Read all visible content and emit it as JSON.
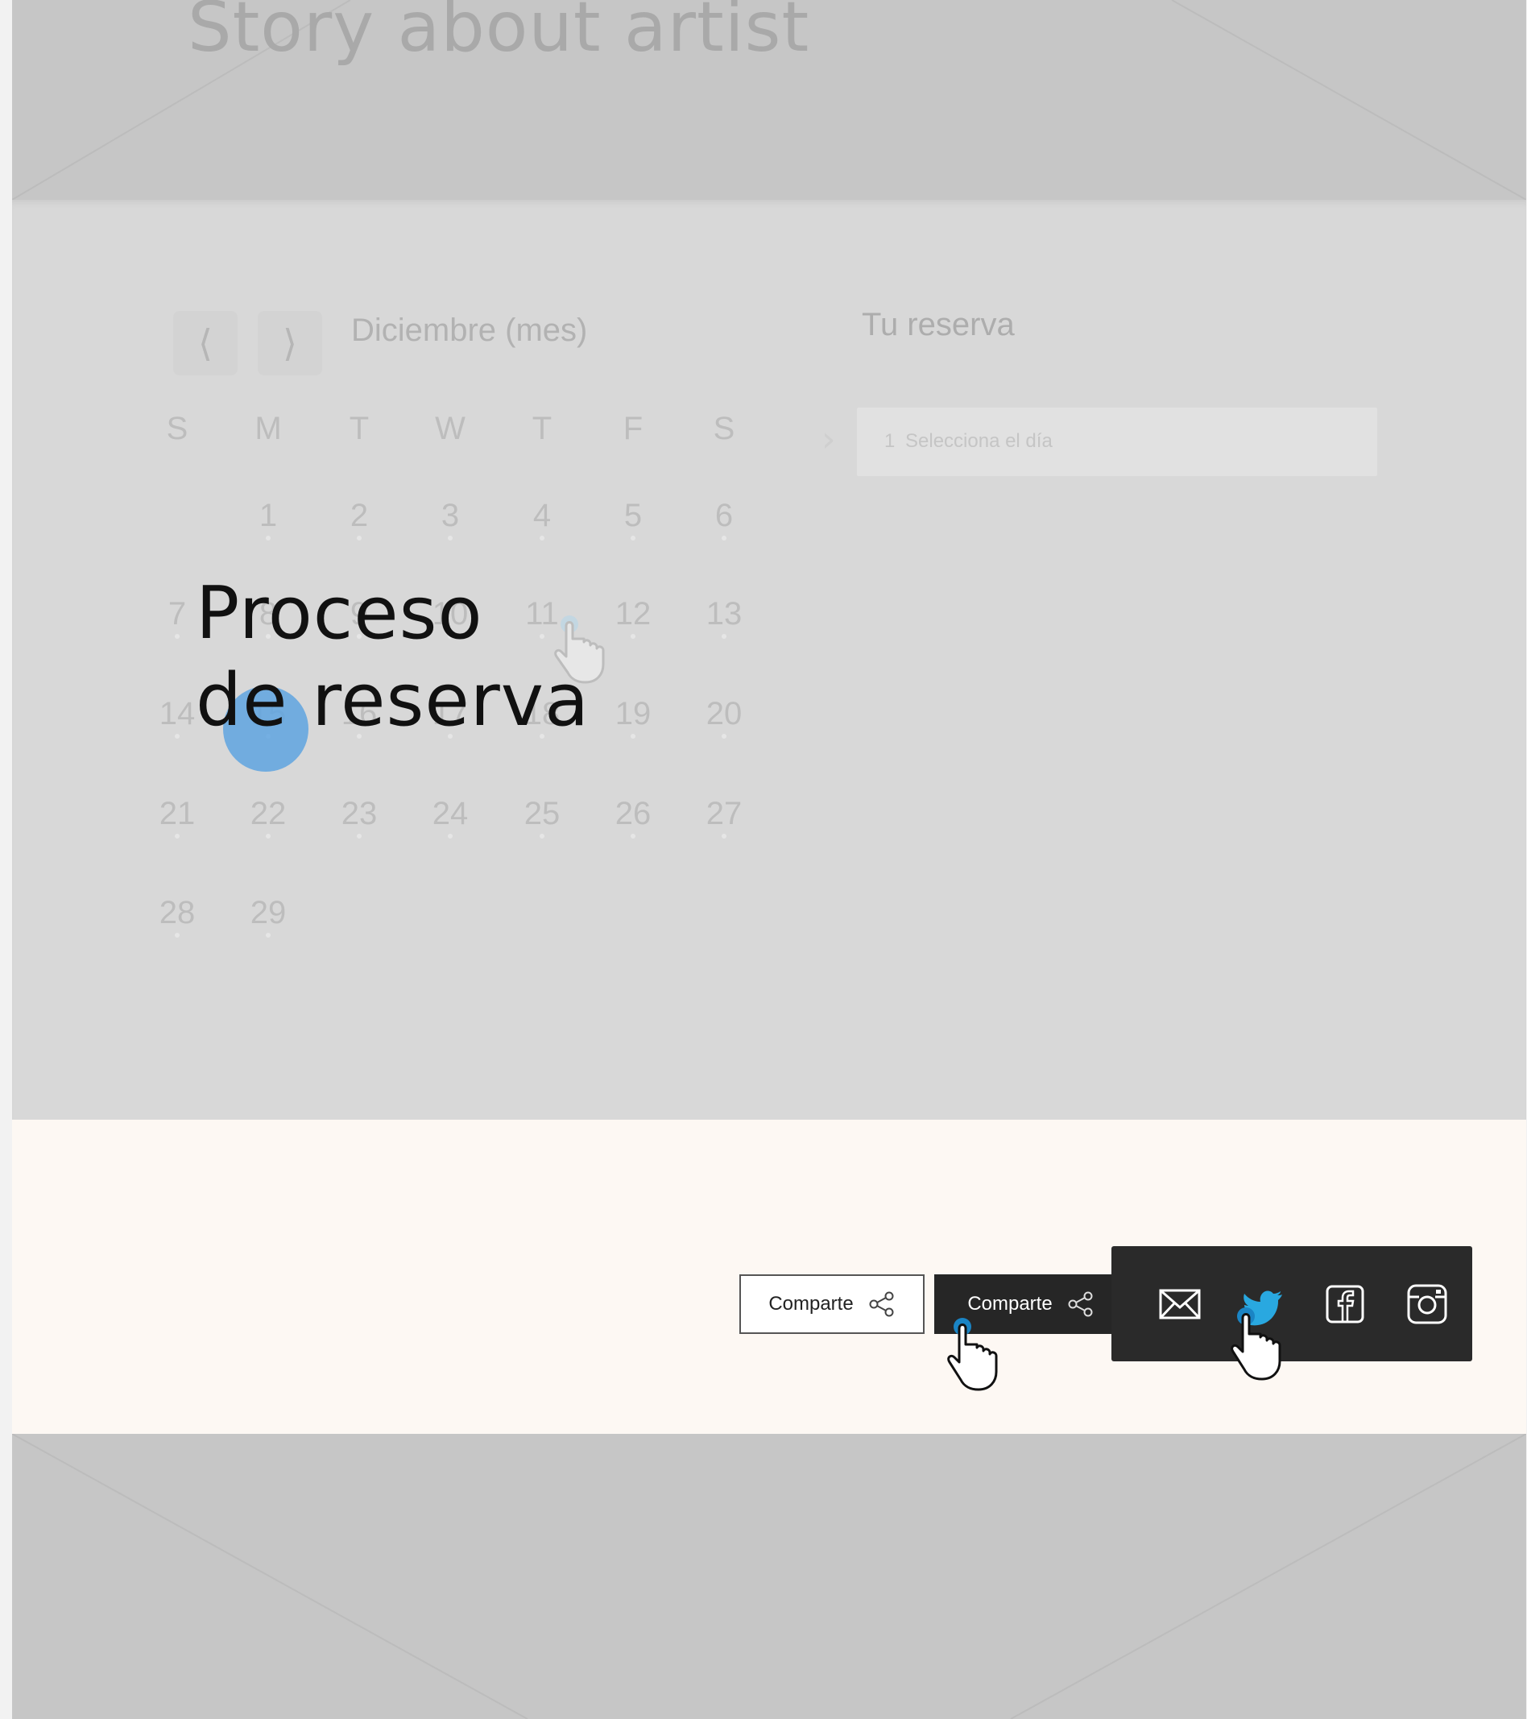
{
  "hero": {
    "title": "Story about artist"
  },
  "calendar": {
    "prev_label": "⟨",
    "next_label": "⟩",
    "month": "Diciembre (mes)",
    "weekdays": [
      "S",
      "M",
      "T",
      "W",
      "T",
      "F",
      "S"
    ],
    "weeks": [
      [
        "",
        "1",
        "2",
        "3",
        "4",
        "5",
        "6"
      ],
      [
        "7",
        "8",
        "9",
        "10",
        "11",
        "12",
        "13"
      ],
      [
        "14",
        "15",
        "16",
        "17",
        "18",
        "19",
        "20"
      ],
      [
        "21",
        "22",
        "23",
        "24",
        "25",
        "26",
        "27"
      ],
      [
        "28",
        "29",
        "",
        "",
        "",
        "",
        ""
      ]
    ]
  },
  "booking": {
    "title": "Tu reserva",
    "step_number": "1",
    "step_placeholder": "Selecciona el día"
  },
  "overlay": {
    "title_line1": "Proceso",
    "title_line2": "de reserva"
  },
  "share": {
    "label_light": "Comparte",
    "label_dark": "Comparte",
    "icons": [
      "mail-icon",
      "twitter-icon",
      "facebook-icon",
      "instagram-icon"
    ],
    "highlight_color": "#29a8e0"
  },
  "colors": {
    "placeholder_gray": "#c6c6c6",
    "calendar_bg": "#d8d8d8",
    "share_bg": "#fdf8f3",
    "dark_panel": "#2a2a2a",
    "accent_blue": "#5fa5e1"
  }
}
